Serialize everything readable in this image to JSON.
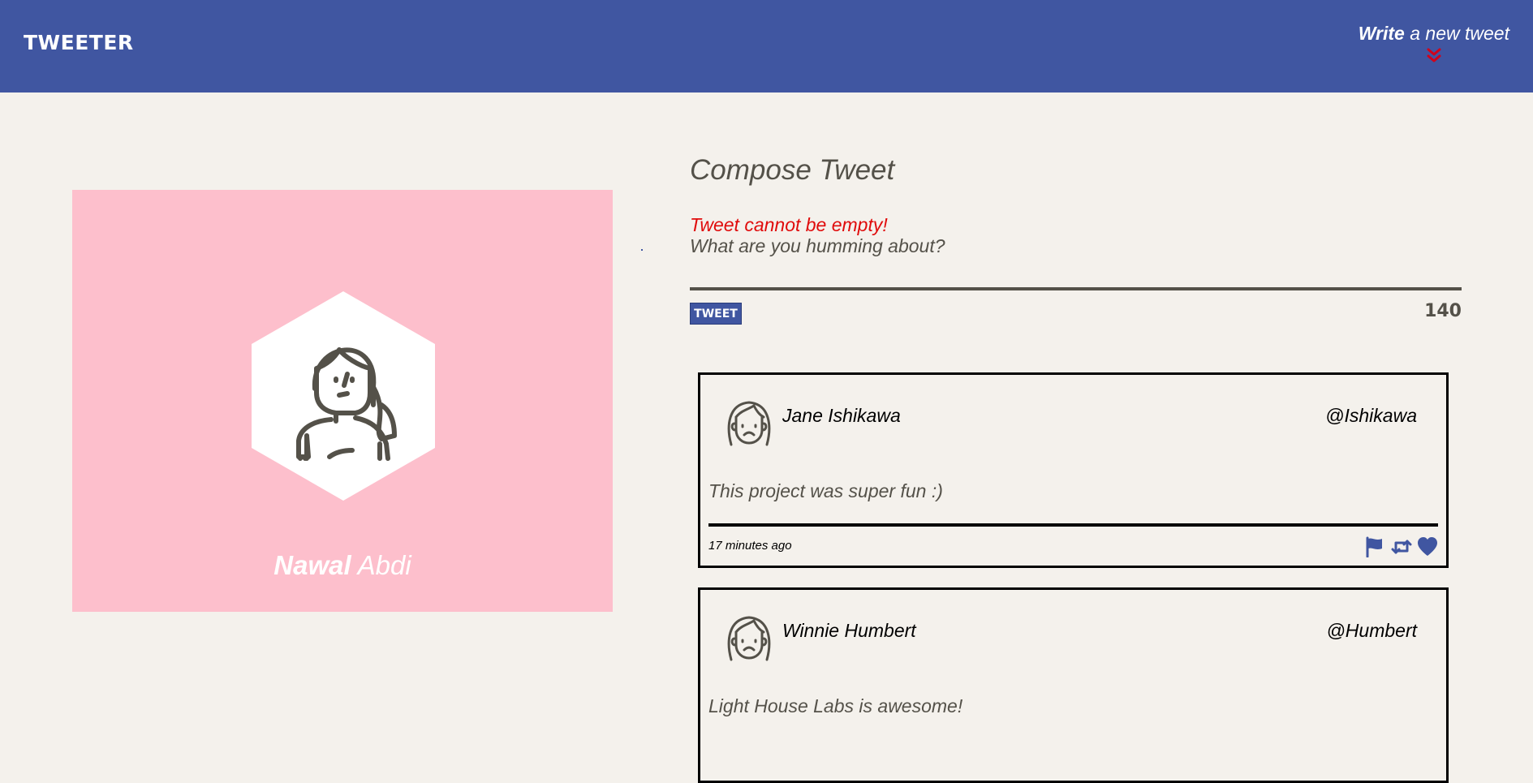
{
  "nav": {
    "logo": "TWEETER",
    "write_bold": "Write",
    "write_rest": " a new tweet",
    "chevron_icon": "double-chevron-down-icon",
    "chevron_color": "#d0021b"
  },
  "profile": {
    "first_name": "Nawal",
    "last_name": "Abdi",
    "background": "#fdbfcc"
  },
  "compose": {
    "title": "Compose Tweet",
    "error": "Tweet cannot be empty!",
    "placeholder": "What are you humming about?",
    "button_label": "TWEET",
    "counter": "140"
  },
  "tweets": [
    {
      "name": "Jane Ishikawa",
      "handle": "@Ishikawa",
      "text": "This project was super fun :)",
      "time": "17 minutes ago"
    },
    {
      "name": "Winnie Humbert",
      "handle": "@Humbert",
      "text": "Light House Labs is awesome!",
      "time": ""
    }
  ],
  "colors": {
    "accent": "#4056a1",
    "background": "#f4f1ec",
    "text": "#545149",
    "error": "#e00b0b"
  },
  "icons": [
    "flag-icon",
    "retweet-icon",
    "heart-icon"
  ]
}
